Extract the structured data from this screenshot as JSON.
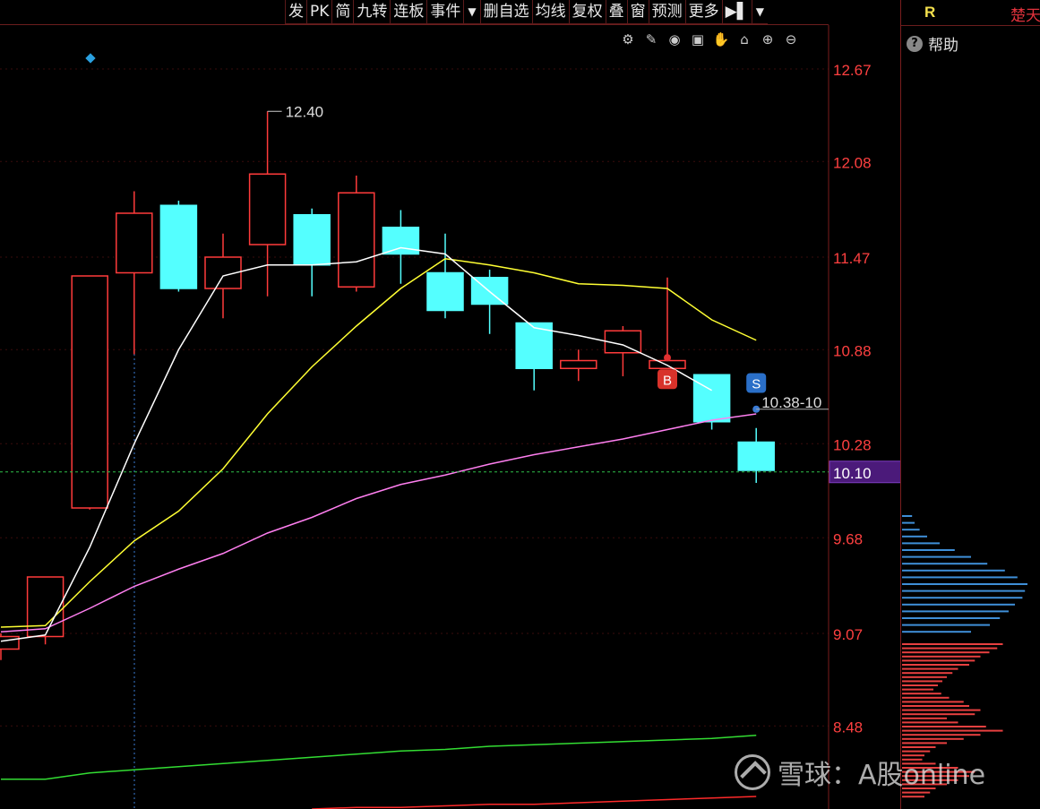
{
  "toolbar": {
    "buttons": [
      "发",
      "PK",
      "简",
      "九转",
      "连板",
      "事件",
      "▼",
      "删自选",
      "均线",
      "复权",
      "叠",
      "窗",
      "预测",
      "更多",
      "▶▌",
      "▼"
    ]
  },
  "icons": [
    "gear-icon",
    "pen-icon",
    "eye-icon",
    "bag-icon",
    "hand-icon",
    "lock-icon",
    "zoom-in-icon",
    "zoom-out-icon"
  ],
  "right_panel": {
    "code_label": "R",
    "stock_name": "楚天",
    "help_label": "帮助"
  },
  "watermark": "雪球：A股online",
  "chart_data": {
    "type": "candlestick",
    "y_ticks": [
      "12.67",
      "12.08",
      "11.47",
      "10.88",
      "10.28",
      "9.68",
      "9.07",
      "8.48"
    ],
    "ylim": [
      7.95,
      12.95
    ],
    "current_price": "10.10",
    "high_annotation": "12.40",
    "range_annotation": "10.38-10",
    "buy_marker": "B",
    "sell_marker": "S",
    "colors": {
      "up": "#ff3b3b",
      "down": "#54ffff",
      "ma5": "#ffffff",
      "ma10": "#ffff33",
      "ma20": "#ff7ff0",
      "ma60": "#33dd33",
      "ma_long": "#ff2a2a",
      "current": "#4b1a7a"
    },
    "candles": [
      {
        "o": 8.97,
        "c": 9.05,
        "h": 9.07,
        "l": 8.9
      },
      {
        "o": 9.05,
        "c": 9.43,
        "h": 9.43,
        "l": 9.0
      },
      {
        "o": 9.87,
        "c": 11.35,
        "h": 11.35,
        "l": 9.86
      },
      {
        "o": 11.37,
        "c": 11.75,
        "h": 11.89,
        "l": 10.85
      },
      {
        "o": 11.8,
        "c": 11.27,
        "h": 11.83,
        "l": 11.25
      },
      {
        "o": 11.27,
        "c": 11.47,
        "h": 11.62,
        "l": 11.08
      },
      {
        "o": 11.55,
        "c": 12.0,
        "h": 12.4,
        "l": 11.22
      },
      {
        "o": 11.74,
        "c": 11.42,
        "h": 11.78,
        "l": 11.22
      },
      {
        "o": 11.28,
        "c": 11.88,
        "h": 11.99,
        "l": 11.25
      },
      {
        "o": 11.66,
        "c": 11.49,
        "h": 11.77,
        "l": 11.3
      },
      {
        "o": 11.37,
        "c": 11.13,
        "h": 11.62,
        "l": 11.08
      },
      {
        "o": 11.34,
        "c": 11.17,
        "h": 11.39,
        "l": 10.98
      },
      {
        "o": 11.05,
        "c": 10.76,
        "h": 11.05,
        "l": 10.62
      },
      {
        "o": 10.76,
        "c": 10.81,
        "h": 10.88,
        "l": 10.68
      },
      {
        "o": 10.86,
        "c": 11.0,
        "h": 11.03,
        "l": 10.71
      },
      {
        "o": 10.76,
        "c": 10.81,
        "h": 11.34,
        "l": 10.76
      },
      {
        "o": 10.72,
        "c": 10.42,
        "h": 10.72,
        "l": 10.37
      },
      {
        "o": 10.29,
        "c": 10.11,
        "h": 10.38,
        "l": 10.03
      }
    ],
    "ma5": [
      9.02,
      9.06,
      9.62,
      10.28,
      10.88,
      11.35,
      11.42,
      11.42,
      11.44,
      11.53,
      11.49,
      11.25,
      11.02,
      10.97,
      10.91,
      10.78,
      10.62,
      null
    ],
    "ma10": [
      9.11,
      9.12,
      9.4,
      9.66,
      9.85,
      10.12,
      10.47,
      10.77,
      11.03,
      11.27,
      11.46,
      11.42,
      11.37,
      11.3,
      11.29,
      11.27,
      11.07,
      10.94
    ],
    "ma20": [
      9.08,
      9.1,
      9.23,
      9.37,
      9.48,
      9.58,
      9.71,
      9.81,
      9.93,
      10.02,
      10.08,
      10.15,
      10.21,
      10.26,
      10.31,
      10.37,
      10.43,
      10.47
    ],
    "ma60": [
      8.14,
      8.14,
      8.18,
      8.2,
      8.22,
      8.24,
      8.26,
      8.28,
      8.3,
      8.32,
      8.33,
      8.35,
      8.36,
      8.37,
      8.38,
      8.39,
      8.4,
      8.42
    ],
    "ma_long": [
      null,
      null,
      null,
      null,
      null,
      null,
      null,
      7.95,
      7.96,
      7.96,
      7.97,
      7.98,
      7.98,
      7.99,
      8.0,
      8.01,
      8.02,
      8.03
    ],
    "buy_index": 15,
    "sell_index": 16,
    "volume_profile_up": [
      0.08,
      0.1,
      0.14,
      0.2,
      0.3,
      0.42,
      0.55,
      0.68,
      0.82,
      0.92,
      1.0,
      0.98,
      0.96,
      0.9,
      0.85,
      0.78,
      0.7,
      0.55
    ],
    "volume_profile_down": [
      0.9,
      0.85,
      0.78,
      0.7,
      0.65,
      0.6,
      0.5,
      0.45,
      0.4,
      0.36,
      0.32,
      0.28,
      0.35,
      0.42,
      0.55,
      0.6,
      0.7,
      0.65,
      0.4,
      0.5,
      0.75,
      0.9,
      0.7,
      0.55,
      0.4,
      0.3,
      0.25,
      0.2,
      0.18,
      0.3,
      0.5,
      0.65,
      0.6,
      0.5,
      0.4,
      0.3,
      0.25,
      0.2
    ]
  }
}
